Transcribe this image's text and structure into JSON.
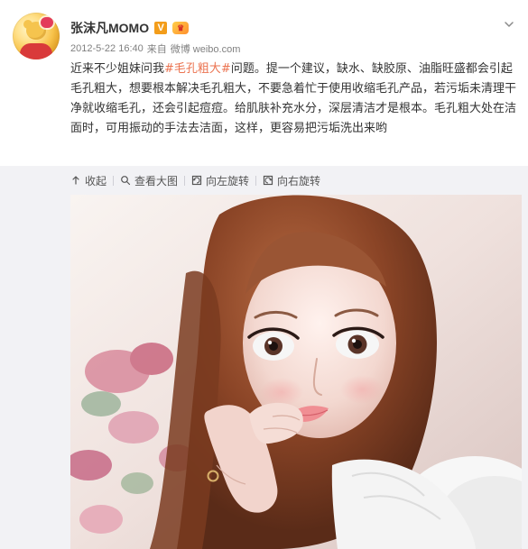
{
  "header": {
    "username": "张沫凡MOMO",
    "verified_badge": "V",
    "vip_badge": "♛",
    "timestamp": "2012-5-22 16:40",
    "source_prefix": "来自",
    "source_name": "微博 weibo.com"
  },
  "post": {
    "content_prefix": "近来不少姐妹问我",
    "hashtag": "#毛孔粗大#",
    "content_suffix": "问题。提一个建议，缺水、缺胶原、油脂旺盛都会引起毛孔粗大，想要根本解决毛孔粗大，不要急着忙于使用收缩毛孔产品，若污垢未清理干净就收缩毛孔，还会引起痘痘。给肌肤补充水分，深层清洁才是根本。毛孔粗大处在洁面时，可用振动的手法去洁面，这样，更容易把污垢洗出来哟"
  },
  "toolbar": {
    "collapse_label": "收起",
    "view_large_label": "查看大图",
    "rotate_left_label": "向左旋转",
    "rotate_right_label": "向右旋转"
  },
  "icons": {
    "menu": "chevron-down-icon",
    "collapse": "arrow-up-icon",
    "search": "search-icon",
    "rotate_left": "rotate-left-icon",
    "rotate_right": "rotate-right-icon"
  },
  "colors": {
    "hashtag": "#eb7350",
    "toolbar_band": "#f2f2f5",
    "verified": "#f39d1a"
  }
}
